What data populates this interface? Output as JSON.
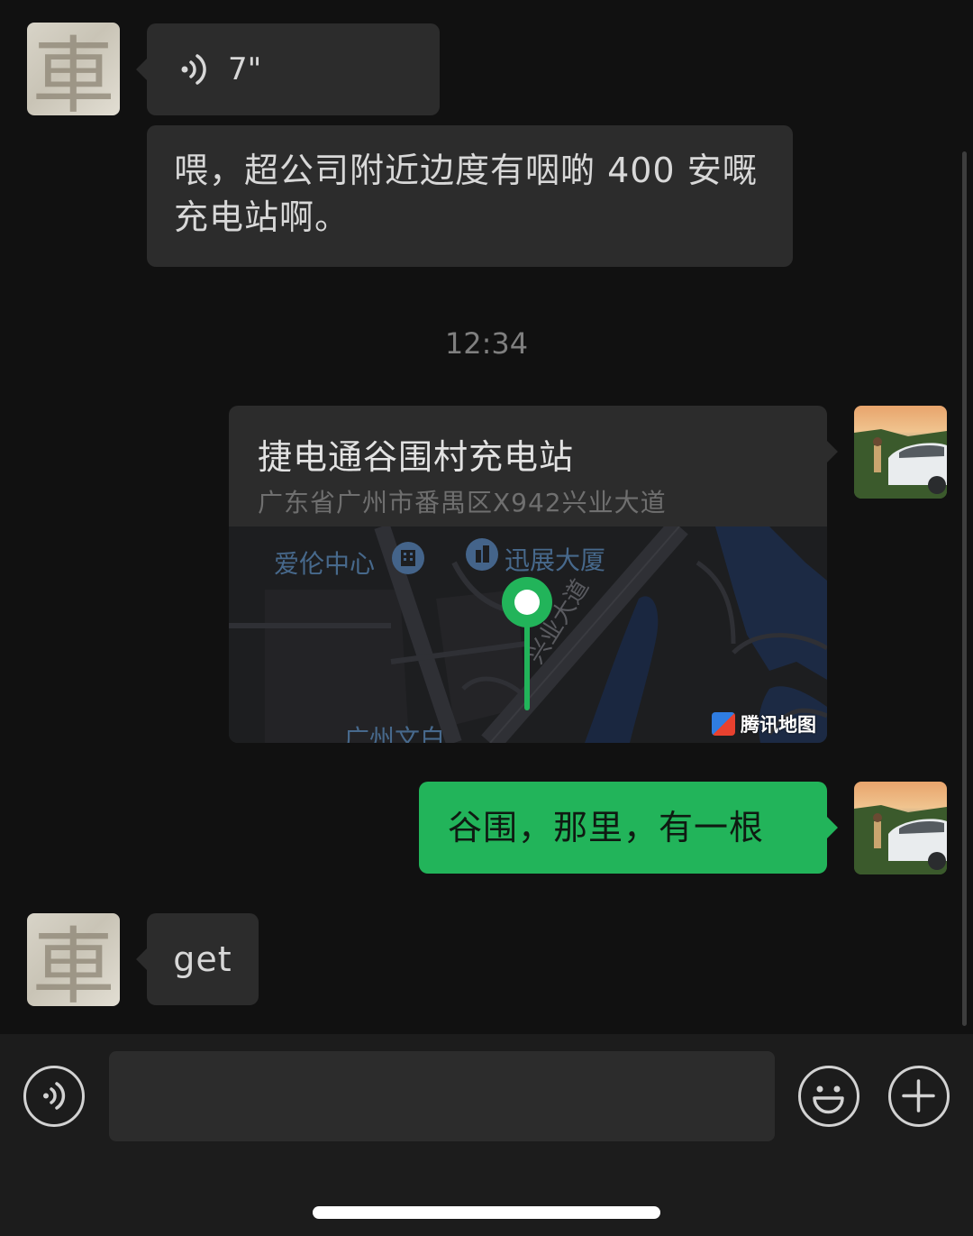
{
  "messages": {
    "voice_duration": "7\"",
    "text_1": "喂，超公司附近边度有咽啲 400 安嘅充电站啊。",
    "timestamp": "12:34",
    "location": {
      "title": "捷电通谷围村充电站",
      "address": "广东省广州市番禺区X942兴业大道",
      "map_labels": {
        "poi_1": "爱伦中心",
        "poi_2": "迅展大厦",
        "road": "兴业大道",
        "poi_3": "广州文白"
      },
      "map_brand": "腾讯地图"
    },
    "text_2": "谷围，那里，有一根",
    "text_3": "get"
  },
  "contact_avatar_char": "車",
  "colors": {
    "background": "#111111",
    "bubble_incoming": "#2c2c2c",
    "bubble_outgoing": "#22b45a",
    "map_pin": "#22b45a"
  },
  "icons": {
    "voice_message": "sound-wave-icon",
    "voice_input": "voice-icon",
    "emoji": "smiley-icon",
    "more": "plus-icon"
  }
}
